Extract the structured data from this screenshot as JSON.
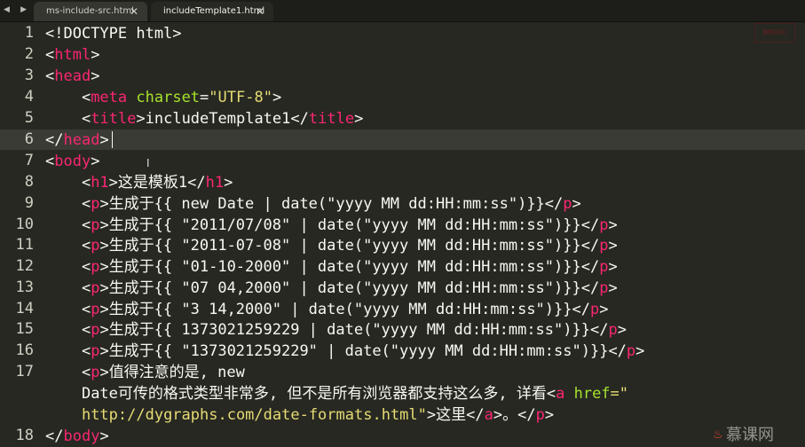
{
  "tabs": [
    {
      "label": "ms-include-src.html",
      "close": "✕"
    },
    {
      "label": "includeTemplate1.html",
      "close": "✕"
    }
  ],
  "nav": {
    "back": "◀",
    "forward": "▶"
  },
  "line_numbers": [
    "1",
    "2",
    "3",
    "4",
    "5",
    "6",
    "7",
    "8",
    "9",
    "10",
    "11",
    "12",
    "13",
    "14",
    "15",
    "16",
    "17",
    "",
    "",
    "18"
  ],
  "code": {
    "l1": "<!DOCTYPE html>",
    "l2_open": "<",
    "l2_tag": "html",
    "l2_close": ">",
    "l3_open": "<",
    "l3_tag": "head",
    "l3_close": ">",
    "l4_tag": "meta",
    "l4_attr": "charset",
    "l4_val": "\"UTF-8\"",
    "l5_tag": "title",
    "l5_text": "includeTemplate1",
    "l6_tag": "head",
    "l7_tag": "body",
    "l8_tag": "h1",
    "l8_text": "这是模板1",
    "p_tag": "p",
    "l9_text": "生成于{{ new Date | date(\"yyyy MM dd:HH:mm:ss\")}}",
    "l10_text": "生成于{{ \"2011/07/08\" | date(\"yyyy MM dd:HH:mm:ss\")}}",
    "l11_text": "生成于{{ \"2011-07-08\" | date(\"yyyy MM dd:HH:mm:ss\")}}",
    "l12_text": "生成于{{ \"01-10-2000\" | date(\"yyyy MM dd:HH:mm:ss\")}}",
    "l13_text": "生成于{{ \"07 04,2000\" | date(\"yyyy MM dd:HH:mm:ss\")}}",
    "l14_text": "生成于{{ \"3 14,2000\" | date(\"yyyy MM dd:HH:mm:ss\")}}",
    "l15_text": "生成于{{ 1373021259229 | date(\"yyyy MM dd:HH:mm:ss\")}}",
    "l16_text": "生成于{{ \"1373021259229\" | date(\"yyyy MM dd:HH:mm:ss\")}}",
    "l17_text": "值得注意的是, new",
    "l17b_text": "Date可传的格式类型非常多, 但不是所有浏览器都支持这么多, 详看",
    "a_tag": "a",
    "href_attr": "href",
    "l17b_quote": "=\"",
    "l17c_url": "http://dygraphs.com/date-formats.html\"",
    "l17c_text": "这里",
    "l17c_tail": "。",
    "l18_tag": "body"
  },
  "watermark": "慕课网",
  "corner_logo": "IMOOC"
}
